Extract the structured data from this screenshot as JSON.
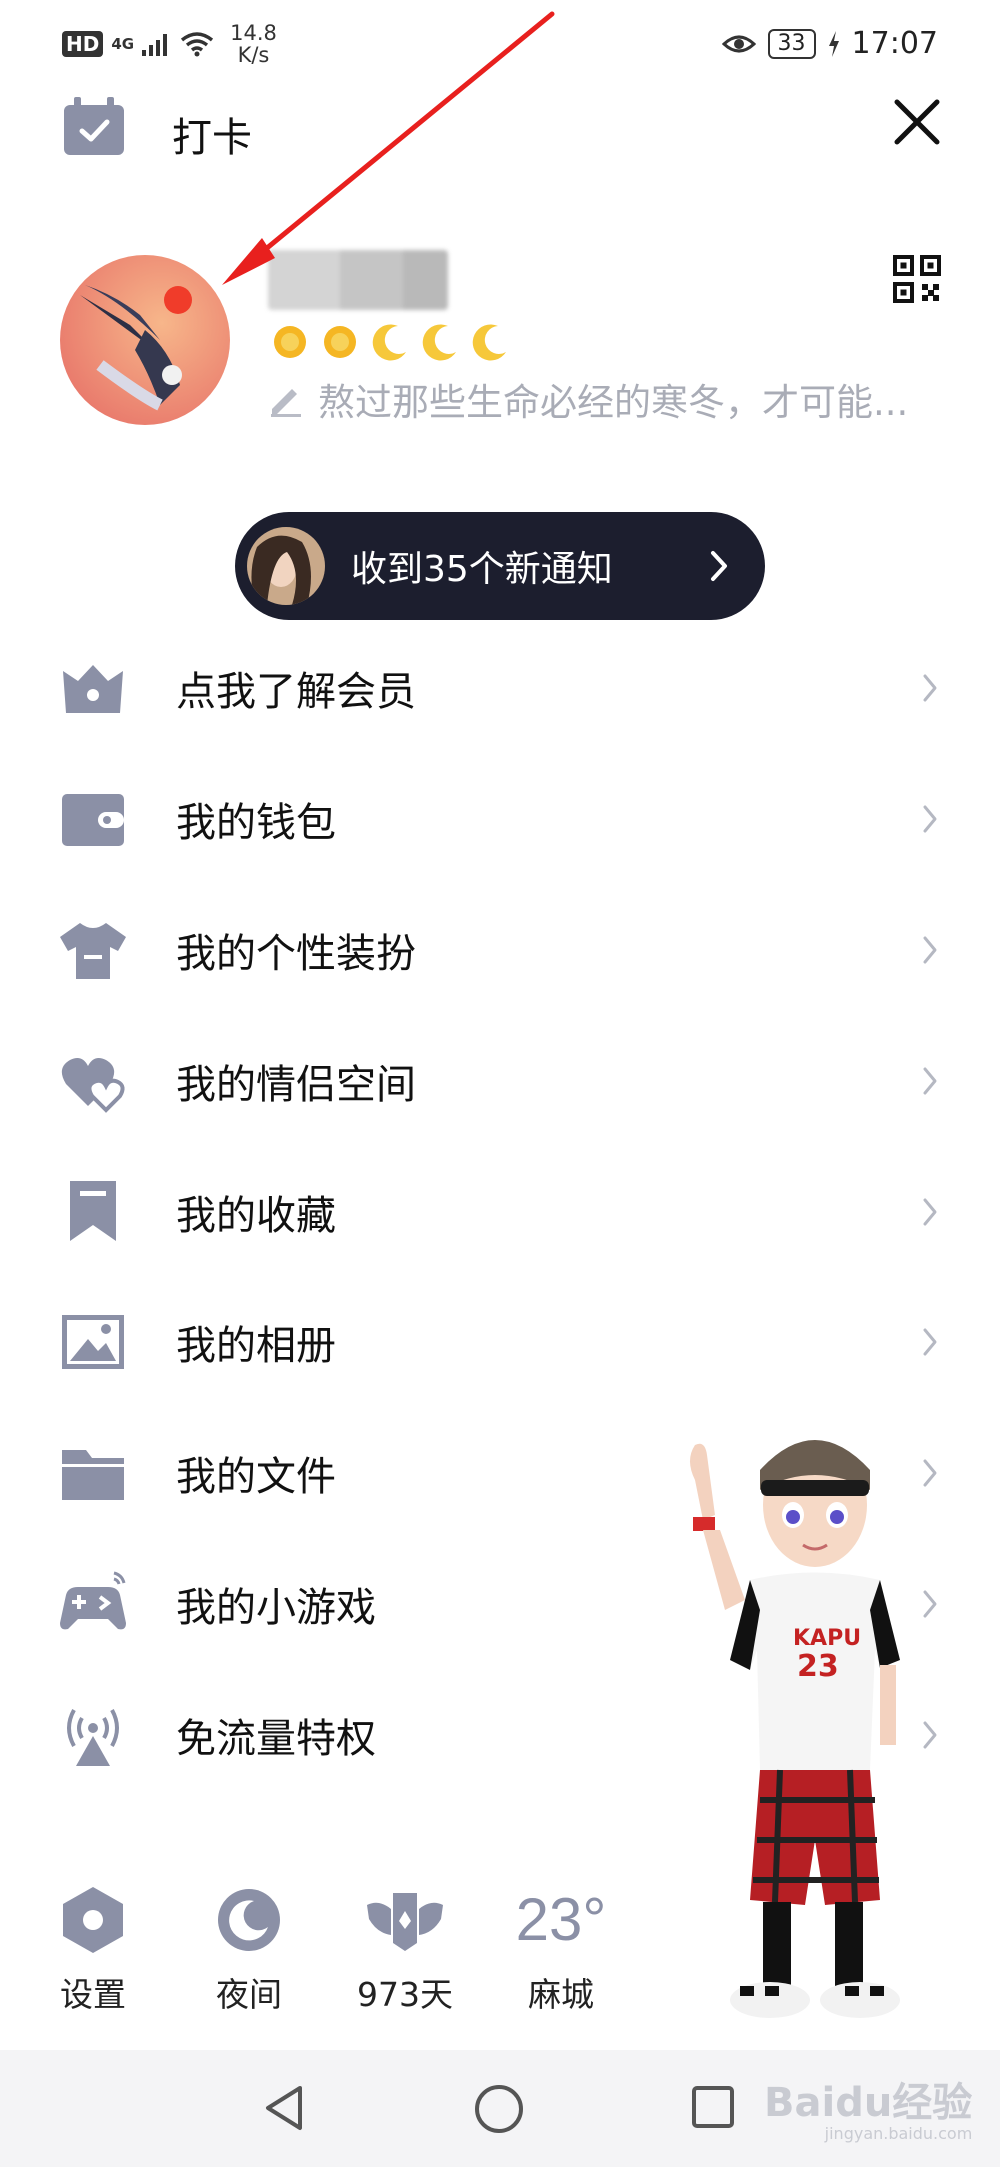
{
  "status_bar": {
    "hd": "HD",
    "network": "4G",
    "speed_value": "14.8",
    "speed_unit": "K/s",
    "battery": "33",
    "time": "17:07"
  },
  "top_bar": {
    "checkin_label": "打卡"
  },
  "profile": {
    "signature": "熬过那些生命必经的寒冬，才可能..."
  },
  "notification": {
    "text": "收到35个新通知"
  },
  "menu": {
    "items": [
      {
        "label": "点我了解会员",
        "icon": "vip-house-icon"
      },
      {
        "label": "我的钱包",
        "icon": "wallet-icon"
      },
      {
        "label": "我的个性装扮",
        "icon": "tshirt-icon"
      },
      {
        "label": "我的情侣空间",
        "icon": "hearts-icon"
      },
      {
        "label": "我的收藏",
        "icon": "bookmark-icon"
      },
      {
        "label": "我的相册",
        "icon": "photo-album-icon"
      },
      {
        "label": "我的文件",
        "icon": "folder-icon"
      },
      {
        "label": "我的小游戏",
        "icon": "gamepad-icon"
      },
      {
        "label": "免流量特权",
        "icon": "signal-tower-icon"
      }
    ]
  },
  "bottom_actions": {
    "settings": "设置",
    "night": "夜间",
    "days": "973天",
    "temperature": "23°",
    "city": "麻城"
  },
  "watermark": {
    "brand": "Baidu经验",
    "url": "jingyan.baidu.com"
  },
  "colors": {
    "icon_gray": "#8b90a6",
    "pill_bg": "#1c1e2e",
    "annotation_red": "#e8201e"
  }
}
